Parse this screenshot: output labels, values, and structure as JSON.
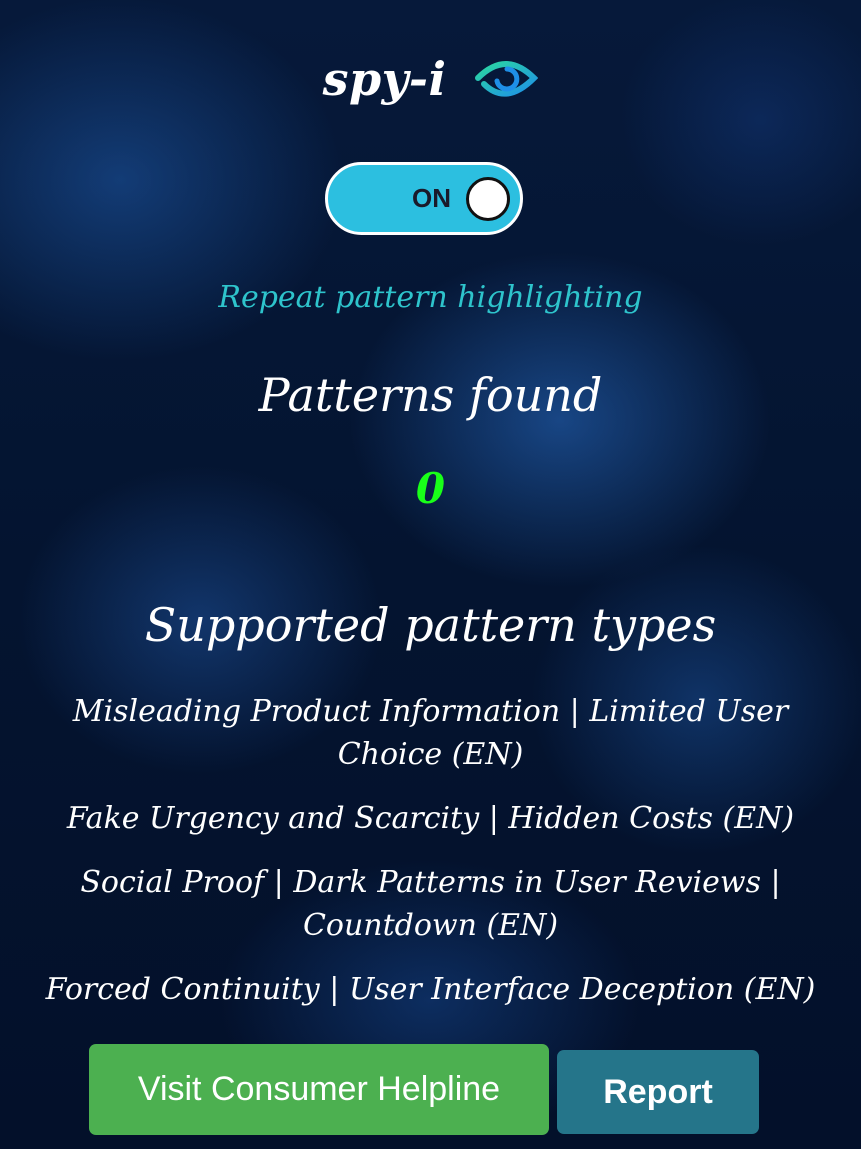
{
  "header": {
    "title": "spy-i",
    "icon": "eye-icon"
  },
  "toggle": {
    "label": "ON",
    "state": "on"
  },
  "subtitle": "Repeat pattern highlighting",
  "patterns": {
    "heading": "Patterns found",
    "count": "0"
  },
  "supported": {
    "heading": "Supported pattern types",
    "items": [
      "Misleading Product Information | Limited User Choice (EN)",
      "Fake Urgency and Scarcity | Hidden Costs (EN)",
      "Social Proof | Dark Patterns in User Reviews | Countdown (EN)",
      "Forced Continuity | User Interface Deception (EN)"
    ]
  },
  "buttons": {
    "helpline": "Visit Consumer Helpline",
    "report": "Report"
  },
  "colors": {
    "accent_teal": "#2ec4cc",
    "toggle_bg": "#2cbfe0",
    "count_green": "#19ff19",
    "helpline_green": "#4cb050",
    "report_teal": "#25758a"
  }
}
